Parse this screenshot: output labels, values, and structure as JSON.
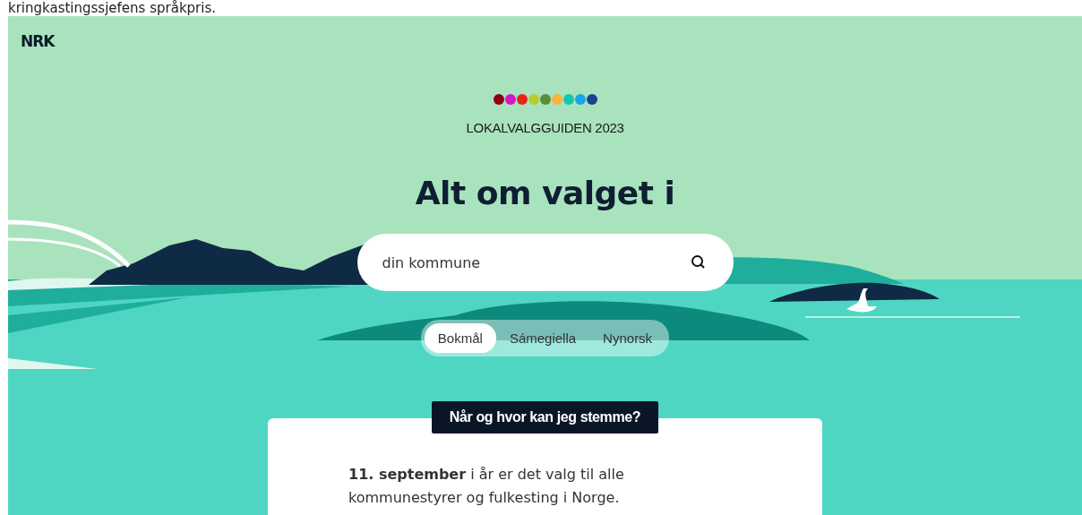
{
  "caption": "kringkastingssjefens språkpris.",
  "logo": "NRK",
  "party_dots": [
    {
      "color": "#8b0011"
    },
    {
      "color": "#d417c8"
    },
    {
      "color": "#e8231c"
    },
    {
      "color": "#b8cc2c"
    },
    {
      "color": "#5b8c3a"
    },
    {
      "color": "#ffb03a"
    },
    {
      "color": "#14c6b0"
    },
    {
      "color": "#1aa3e8"
    },
    {
      "color": "#18448f"
    }
  ],
  "kicker": "LOKALVALGGUIDEN 2023",
  "heading": "Alt om valget i",
  "search": {
    "placeholder": "din kommune"
  },
  "languages": [
    {
      "label": "Bokmål",
      "selected": true
    },
    {
      "label": "Sámegiella",
      "selected": false
    },
    {
      "label": "Nynorsk",
      "selected": false
    }
  ],
  "card": {
    "label": "Når og hvor kan jeg stemme?",
    "text": "**11. september** i år er det valg til alle kommunestyrer og fulkesting i Norge."
  }
}
